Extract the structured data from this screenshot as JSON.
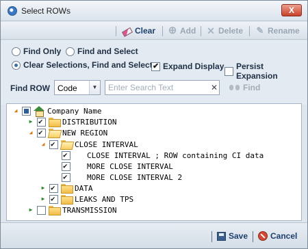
{
  "window": {
    "title": "Select ROWs",
    "close_label": "X"
  },
  "toolbar": {
    "clear": "Clear",
    "add": "Add",
    "delete": "Delete",
    "rename": "Rename"
  },
  "options": {
    "find_only": "Find Only",
    "find_and_select": "Find and Select",
    "clear_find_select": "Clear Selections, Find and Select",
    "selected_radio": "clear_find_select",
    "expand_display": {
      "label": "Expand Display",
      "checked": true
    },
    "persist_expansion": {
      "label": "Persist Expansion",
      "checked": false
    }
  },
  "find": {
    "label": "Find ROW",
    "field_value": "Code",
    "search_value": "",
    "search_placeholder": "Enter Search Text",
    "find_label": "Find"
  },
  "tree": {
    "root": "Company Name",
    "distribution": "DISTRIBUTION",
    "new_region": "NEW REGION",
    "close_interval": "CLOSE INTERVAL",
    "ci_row1": "CLOSE INTERVAL ; ROW containing CI data",
    "ci_row2": "MORE CLOSE INTERVAL",
    "ci_row3": "MORE CLOSE INTERVAL 2",
    "data": "DATA",
    "leaks_tps": "LEAKS AND TPS",
    "transmission": "TRANSMISSION"
  },
  "footer": {
    "save": "Save",
    "cancel": "Cancel"
  }
}
